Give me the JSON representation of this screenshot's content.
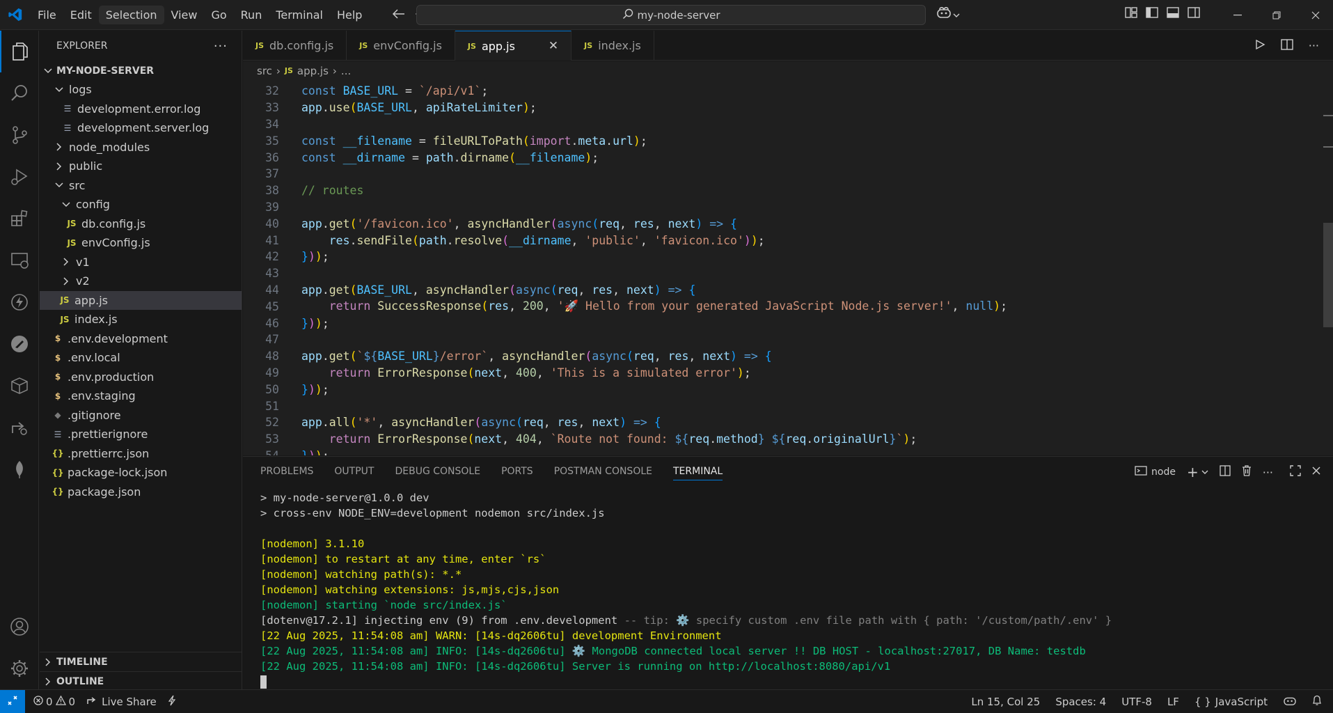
{
  "titlebar": {
    "menu": [
      "File",
      "Edit",
      "Selection",
      "View",
      "Go",
      "Run",
      "Terminal",
      "Help"
    ],
    "search_text": "my-node-server"
  },
  "explorer": {
    "title": "EXPLORER",
    "root": "MY-NODE-SERVER",
    "items": [
      {
        "label": "logs",
        "type": "folder-open"
      },
      {
        "label": "development.error.log",
        "type": "log"
      },
      {
        "label": "development.server.log",
        "type": "log"
      },
      {
        "label": "node_modules",
        "type": "folder"
      },
      {
        "label": "public",
        "type": "folder"
      },
      {
        "label": "src",
        "type": "folder-open"
      },
      {
        "label": "config",
        "type": "folder-open"
      },
      {
        "label": "db.config.js",
        "type": "js"
      },
      {
        "label": "envConfig.js",
        "type": "js"
      },
      {
        "label": "v1",
        "type": "folder"
      },
      {
        "label": "v2",
        "type": "folder"
      },
      {
        "label": "app.js",
        "type": "js"
      },
      {
        "label": "index.js",
        "type": "js"
      },
      {
        "label": ".env.development",
        "type": "env"
      },
      {
        "label": ".env.local",
        "type": "env"
      },
      {
        "label": ".env.production",
        "type": "env"
      },
      {
        "label": ".env.staging",
        "type": "env"
      },
      {
        "label": ".gitignore",
        "type": "git"
      },
      {
        "label": ".prettierignore",
        "type": "lines"
      },
      {
        "label": ".prettierrc.json",
        "type": "json"
      },
      {
        "label": "package-lock.json",
        "type": "json"
      },
      {
        "label": "package.json",
        "type": "json"
      }
    ],
    "timeline": "TIMELINE",
    "outline": "OUTLINE"
  },
  "tabs": [
    {
      "label": "db.config.js"
    },
    {
      "label": "envConfig.js"
    },
    {
      "label": "app.js"
    },
    {
      "label": "index.js"
    }
  ],
  "breadcrumb": {
    "folder": "src",
    "file": "app.js",
    "more": "..."
  },
  "editor": {
    "line_numbers": [
      "32",
      "33",
      "34",
      "35",
      "36",
      "37",
      "38",
      "39",
      "40",
      "41",
      "42",
      "43",
      "44",
      "45",
      "46",
      "47",
      "48",
      "49",
      "50",
      "51",
      "52",
      "53",
      "54"
    ]
  },
  "panel": {
    "tabs": [
      "PROBLEMS",
      "OUTPUT",
      "DEBUG CONSOLE",
      "PORTS",
      "POSTMAN CONSOLE",
      "TERMINAL"
    ],
    "shell": "node",
    "terminal_lines": [
      {
        "text": "> my-node-server@1.0.0 dev",
        "color": "w"
      },
      {
        "text": "> cross-env NODE_ENV=development nodemon src/index.js",
        "color": "w"
      },
      {
        "text": "",
        "color": "w"
      },
      {
        "text": "[nodemon] 3.1.10",
        "color": "y"
      },
      {
        "text": "[nodemon] to restart at any time, enter `rs`",
        "color": "y"
      },
      {
        "text": "[nodemon] watching path(s): *.*",
        "color": "y"
      },
      {
        "text": "[nodemon] watching extensions: js,mjs,cjs,json",
        "color": "y"
      },
      {
        "text": "[nodemon] starting `node src/index.js`",
        "color": "g"
      }
    ],
    "dotenv_line": {
      "prefix": "[dotenv@17.2.1] injecting env (9) from .env.development",
      "tip": " -- tip: ⚙️ specify custom .env file path with { path: '/custom/path/.env' }"
    },
    "log_lines": [
      {
        "text": "[22 Aug 2025, 11:54:08 am] WARN: [14s-dq2606tu] development Environment",
        "color": "y"
      },
      {
        "text": "[22 Aug 2025, 11:54:08 am] INFO: [14s-dq2606tu] ⚙️ MongoDB connected local server !! DB HOST - localhost:27017, DB Name: testdb",
        "color": "g"
      },
      {
        "text": "[22 Aug 2025, 11:54:08 am] INFO: [14s-dq2606tu] Server is running on http://localhost:8080/api/v1",
        "color": "g"
      }
    ]
  },
  "statusbar": {
    "errors": "0",
    "warnings": "0",
    "live_share": "Live Share",
    "position": "Ln 15, Col 25",
    "spaces": "Spaces: 4",
    "encoding": "UTF-8",
    "eol": "LF",
    "language": "JavaScript"
  },
  "colors": {
    "accent": "#0078d4",
    "editor_bg": "#1f1f1f",
    "sidebar_bg": "#181818"
  }
}
